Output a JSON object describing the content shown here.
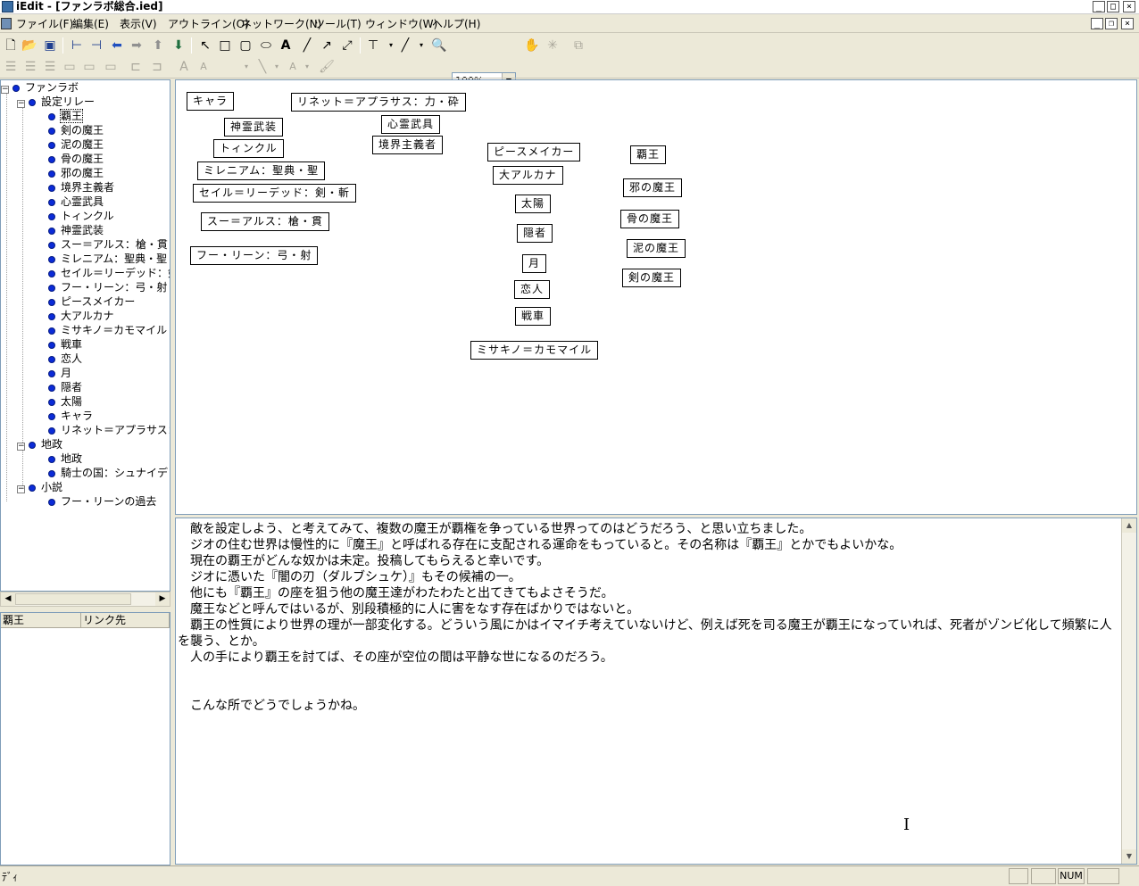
{
  "window": {
    "title": "iEdit - [ファンラボ総合.ied]"
  },
  "menu": [
    "ファイル(F)",
    "編集(E)",
    "表示(V)",
    "アウトライン(O)",
    "ネットワーク(N)",
    "ツール(T)",
    "ウィンドウ(W)",
    "ヘルプ(H)"
  ],
  "toolbar": {
    "zoom": "100%"
  },
  "tree": {
    "root": "ファンラボ",
    "groups": [
      {
        "label": "設定リレー",
        "items": [
          "覇王",
          "剣の魔王",
          "泥の魔王",
          "骨の魔王",
          "邪の魔王",
          "境界主義者",
          "心霊武具",
          "トィンクル",
          "神霊武装",
          "スー＝アルス：槍・貫",
          "ミレニアム：聖典・聖",
          "セイル＝リーデッド：剣",
          "フー・リーン：弓・射",
          "ピースメイカー",
          "大アルカナ",
          "ミサキノ＝カモマイル",
          "戦車",
          "恋人",
          "月",
          "隠者",
          "太陽",
          "キャラ",
          "リネット＝アプラサス："
        ]
      },
      {
        "label": "地政",
        "items": [
          "地政",
          "騎士の国：シュナイデ"
        ]
      },
      {
        "label": "小説",
        "items": [
          "フー・リーンの過去"
        ]
      }
    ]
  },
  "linklist": {
    "col1": "覇王",
    "col2": "リンク先"
  },
  "canvas": {
    "nodes": [
      "キャラ",
      "リネット＝アプラサス：力・砕",
      "神霊武装",
      "心霊武具",
      "トィンクル",
      "境界主義者",
      "ミレニアム：聖典・聖",
      "ピースメイカー",
      "大アルカナ",
      "覇王",
      "セイル＝リーデッド：剣・斬",
      "邪の魔王",
      "太陽",
      "スー＝アルス：槍・貫",
      "骨の魔王",
      "隠者",
      "泥の魔王",
      "フー・リーン：弓・射",
      "月",
      "剣の魔王",
      "恋人",
      "戦車",
      "ミサキノ＝カモマイル"
    ]
  },
  "text": {
    "body": "　敵を設定しよう、と考えてみて、複数の魔王が覇権を争っている世界ってのはどうだろう、と思い立ちました。\n　ジオの住む世界は慢性的に『魔王』と呼ばれる存在に支配される運命をもっていると。その名称は『覇王』とかでもよいかな。\n　現在の覇王がどんな奴かは未定。投稿してもらえると幸いです。\n　ジオに憑いた『闇の刃（ダルブシュケ）』もその候補の一。\n　他にも『覇王』の座を狙う他の魔王達がわたわたと出てきてもよさそうだ。\n　魔王などと呼んではいるが、別段積極的に人に害をなす存在ばかりではないと。\n　覇王の性質により世界の理が一部変化する。どういう風にかはイマイチ考えていないけど、例えば死を司る魔王が覇王になっていれば、死者がゾンビ化して頻繁に人を襲う、とか。\n　人の手により覇王を討てば、その座が空位の間は平静な世になるのだろう。\n\n\n　こんな所でどうでしょうかね。"
  },
  "status": {
    "message": "ﾃﾞｨ",
    "num": "NUM"
  }
}
